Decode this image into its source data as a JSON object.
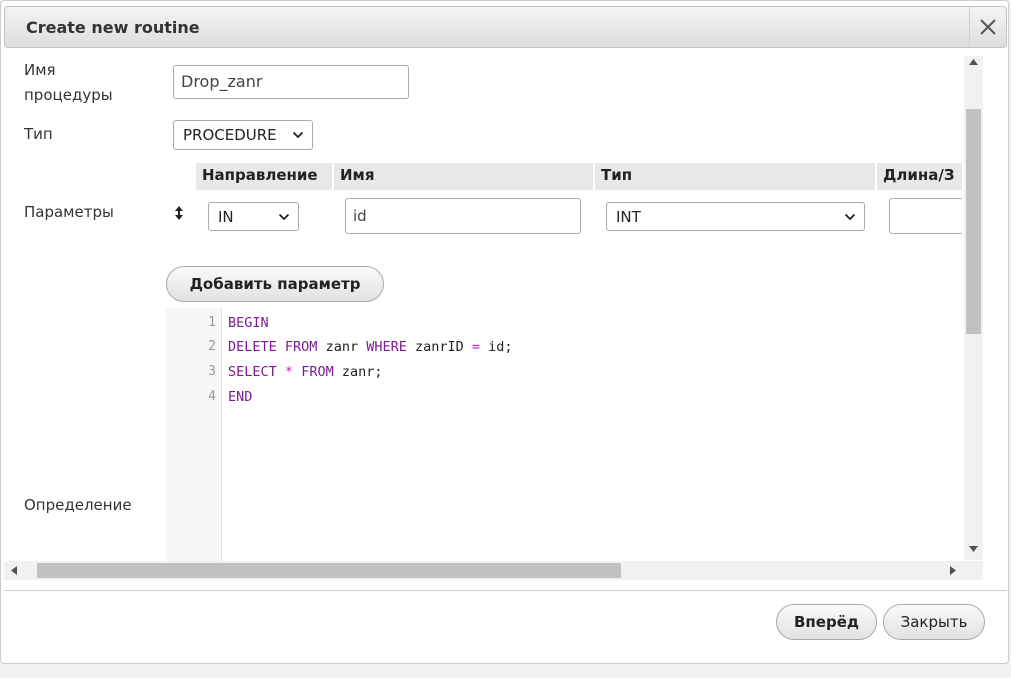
{
  "dialog": {
    "title": "Create new routine",
    "close_icon": "close-icon"
  },
  "form": {
    "name_label": "Имя\nпроцедуры",
    "name_value": "Drop_zanr",
    "type_label": "Тип",
    "type_value": "PROCEDURE",
    "params_label": "Параметры",
    "definition_label": "Определение"
  },
  "params": {
    "headers": [
      "Направление",
      "Имя",
      "Тип",
      "Длина/З"
    ],
    "row": {
      "direction": "IN",
      "name": "id",
      "type": "INT",
      "length": ""
    },
    "reorder_icon": "sort-arrows-icon",
    "add_button": "Добавить параметр"
  },
  "editor": {
    "line_numbers": [
      "1",
      "2",
      "3",
      "4"
    ],
    "lines": [
      [
        {
          "t": "BEGIN",
          "c": "kw"
        }
      ],
      [
        {
          "t": "DELETE",
          "c": "kw"
        },
        {
          "t": " "
        },
        {
          "t": "FROM",
          "c": "kw"
        },
        {
          "t": " zanr "
        },
        {
          "t": "WHERE",
          "c": "kw"
        },
        {
          "t": " zanrID "
        },
        {
          "t": "=",
          "c": "op"
        },
        {
          "t": " id;"
        }
      ],
      [
        {
          "t": "SELECT",
          "c": "kw"
        },
        {
          "t": " "
        },
        {
          "t": "*",
          "c": "op"
        },
        {
          "t": " "
        },
        {
          "t": "FROM",
          "c": "kw"
        },
        {
          "t": " zanr;"
        }
      ],
      [
        {
          "t": "END",
          "c": "kw"
        }
      ]
    ]
  },
  "footer": {
    "go_button": "Вперёд",
    "close_button": "Закрыть"
  }
}
